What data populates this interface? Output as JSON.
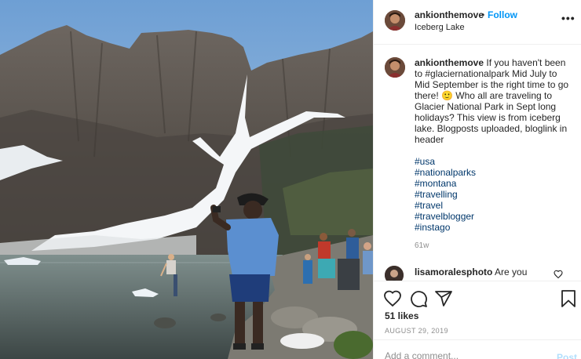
{
  "photo": {
    "alt": "",
    "colors": {
      "sky": "#8fb3d6",
      "rock": "#5c5650",
      "snow": "#f4f6f8",
      "lake": "#5d6f72",
      "shirt": "#5b8fd0"
    }
  },
  "header": {
    "username": "ankionthemove",
    "separator": "•",
    "follow_label": "Follow",
    "location": "Iceberg Lake",
    "more_label": "•••"
  },
  "caption": {
    "username": "ankionthemove",
    "text": "If you haven't been to #glaciernationalpark Mid July to Mid September is the right time to go there! 🙂 Who all are traveling to Glacier National Park in Sept long holidays? This view is from iceberg lake. Blogposts uploaded, bloglink in header",
    "hashtags": [
      "#usa",
      "#nationalparks",
      "#montana",
      "#travelling",
      "#travel",
      "#travelblogger",
      "#instago"
    ],
    "age": "61w"
  },
  "comment": {
    "username": "lisamoralesphoto",
    "text": "Are you"
  },
  "actions": {
    "icons": [
      "heart-icon",
      "comment-icon",
      "share-icon",
      "bookmark-icon"
    ],
    "likes": "51 likes",
    "date": "AUGUST 29, 2019"
  },
  "add_comment": {
    "placeholder": "Add a comment...",
    "post_label": "Post"
  },
  "colors": {
    "link": "#0095f6",
    "hashtag": "#00376b",
    "muted": "#8e8e8e",
    "post_disabled": "#b2dffc",
    "border": "#efefef"
  }
}
